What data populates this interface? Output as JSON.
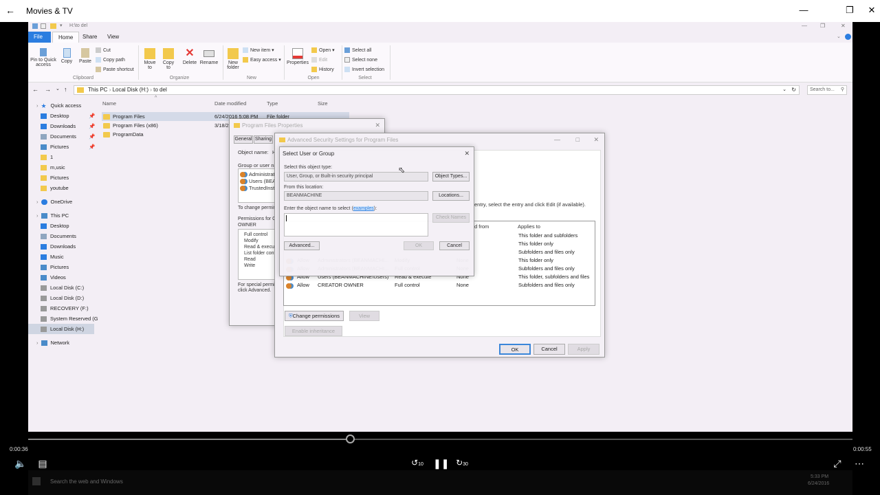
{
  "app": {
    "title": "Movies & TV"
  },
  "explorer": {
    "quick_access_path": "H:\\to del",
    "tabs": [
      "File",
      "Home",
      "Share",
      "View"
    ],
    "ribbon": {
      "pin_label": "Pin to Quick access",
      "copy_label": "Copy",
      "paste_label": "Paste",
      "cut_label": "Cut",
      "copy_path_label": "Copy path",
      "paste_shortcut_label": "Paste shortcut",
      "clipboard_group": "Clipboard",
      "move_to_label": "Move to",
      "copy_to_label": "Copy to",
      "delete_label": "Delete",
      "rename_label": "Rename",
      "organize_group": "Organize",
      "new_folder_label": "New folder",
      "new_item_label": "New item",
      "easy_access_label": "Easy access",
      "new_group": "New",
      "properties_label": "Properties",
      "open_label": "Open",
      "edit_label": "Edit",
      "history_label": "History",
      "open_group": "Open",
      "select_all_label": "Select all",
      "select_none_label": "Select none",
      "invert_selection_label": "Invert selection",
      "select_group": "Select"
    },
    "breadcrumb": [
      "This PC",
      "Local Disk (H:)",
      "to del"
    ],
    "search_placeholder": "Search to...",
    "nav": [
      {
        "label": "Quick access",
        "icon": "star-icon"
      },
      {
        "label": "Desktop",
        "icon": "desktop-icon"
      },
      {
        "label": "Downloads",
        "icon": "download-icon"
      },
      {
        "label": "Documents",
        "icon": "document-icon"
      },
      {
        "label": "Pictures",
        "icon": "picture-icon"
      },
      {
        "label": "1",
        "icon": "folder-icon"
      },
      {
        "label": "m,usic",
        "icon": "folder-icon"
      },
      {
        "label": "Pictures",
        "icon": "folder-icon"
      },
      {
        "label": "youtube",
        "icon": "folder-icon"
      },
      {
        "label": "OneDrive",
        "icon": "cloud-icon"
      },
      {
        "label": "This PC",
        "icon": "computer-icon"
      },
      {
        "label": "Desktop",
        "icon": "desktop-icon"
      },
      {
        "label": "Documents",
        "icon": "document-icon"
      },
      {
        "label": "Downloads",
        "icon": "download-icon"
      },
      {
        "label": "Music",
        "icon": "music-icon"
      },
      {
        "label": "Pictures",
        "icon": "picture-icon"
      },
      {
        "label": "Videos",
        "icon": "video-icon"
      },
      {
        "label": "Local Disk (C:)",
        "icon": "drive-icon"
      },
      {
        "label": "Local Disk (D:)",
        "icon": "drive-icon"
      },
      {
        "label": "RECOVERY (F:)",
        "icon": "drive-icon"
      },
      {
        "label": "System Reserved (G",
        "icon": "drive-icon"
      },
      {
        "label": "Local Disk (H:)",
        "icon": "drive-icon"
      },
      {
        "label": "Network",
        "icon": "network-icon"
      }
    ],
    "columns": [
      "Name",
      "Date modified",
      "Type",
      "Size"
    ],
    "files": [
      {
        "name": "Program Files",
        "date": "6/24/2016 5:08 PM",
        "type": "File folder"
      },
      {
        "name": "Program Files (x86)",
        "date": "3/18/2",
        "type": ""
      },
      {
        "name": "ProgramData",
        "date": "",
        "type": ""
      }
    ],
    "status": "1 item selected"
  },
  "props_dialog": {
    "title": "Program Files Properties",
    "tabs": [
      "General",
      "Sharing"
    ],
    "object_name_label": "Object name:",
    "object_name_value": "H",
    "group_label": "Group or user nam",
    "users": [
      "Administrator",
      "Users (BEAN",
      "TrustedInstal"
    ],
    "change_perm_text": "To change permiss",
    "perm_for": "Permissions for CF",
    "owner": "OWNER",
    "perms": [
      "Full control",
      "Modify",
      "Read & execute",
      "List folder conte",
      "Read",
      "Write"
    ],
    "special_text_1": "For special permiss",
    "special_text_2": "click Advanced."
  },
  "adv_dialog": {
    "title": "Advanced Security Settings for Program Files",
    "hint": "entry, select the entry and click Edit (if available).",
    "col_inherited": "d from",
    "col_applies": "Applies to",
    "entries": [
      {
        "type": "",
        "principal": "",
        "access": "",
        "inherited": "",
        "applies": "This folder and subfolders"
      },
      {
        "type": "",
        "principal": "",
        "access": "",
        "inherited": "",
        "applies": "This folder only"
      },
      {
        "type": "",
        "principal": "",
        "access": "",
        "inherited": "",
        "applies": "Subfolders and files only"
      },
      {
        "type": "Allow",
        "principal": "Administrators (BEANMACHI...",
        "access": "Modify",
        "inherited": "None",
        "applies": "This folder only"
      },
      {
        "type": "Allow",
        "principal": "Administrators (BEANMACHI...",
        "access": "Full control",
        "inherited": "None",
        "applies": "Subfolders and files only"
      },
      {
        "type": "Allow",
        "principal": "Users (BEANMACHINE\\Users)",
        "access": "Read & execute",
        "inherited": "None",
        "applies": "This folder, subfolders and files"
      },
      {
        "type": "Allow",
        "principal": "CREATOR OWNER",
        "access": "Full control",
        "inherited": "None",
        "applies": "Subfolders and files only"
      }
    ],
    "change_perm_btn": "Change permissions",
    "view_btn": "View",
    "enable_inh_btn": "Enable inheritance",
    "ok": "OK",
    "cancel": "Cancel",
    "apply": "Apply"
  },
  "select_dialog": {
    "title": "Select User or Group",
    "obj_type_label": "Select this object type:",
    "obj_type_value": "User, Group, or Built-in security principal",
    "object_types_btn": "Object Types...",
    "location_label": "From this location:",
    "location_value": "BEANMACHINE",
    "locations_btn": "Locations...",
    "enter_label": "Enter the object name to select",
    "examples_link": "examples",
    "enter_label_suffix": "):",
    "check_names_btn": "Check Names",
    "advanced_btn": "Advanced...",
    "ok": "OK",
    "cancel": "Cancel"
  },
  "player": {
    "elapsed": "0:00:36",
    "remaining": "0:00:55",
    "progress": 0.39,
    "skip_back": "10",
    "skip_fwd": "30"
  },
  "taskbar": {
    "search_placeholder": "Search the web and Windows",
    "time": "5:33 PM",
    "date": "6/24/2016"
  }
}
